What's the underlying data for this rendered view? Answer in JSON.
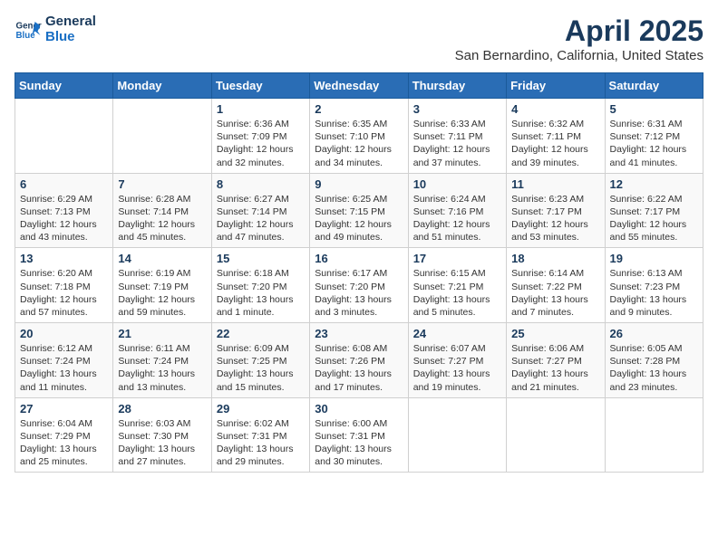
{
  "header": {
    "logo_line1": "General",
    "logo_line2": "Blue",
    "title": "April 2025",
    "subtitle": "San Bernardino, California, United States"
  },
  "weekdays": [
    "Sunday",
    "Monday",
    "Tuesday",
    "Wednesday",
    "Thursday",
    "Friday",
    "Saturday"
  ],
  "weeks": [
    [
      {
        "day": "",
        "info": ""
      },
      {
        "day": "",
        "info": ""
      },
      {
        "day": "1",
        "info": "Sunrise: 6:36 AM\nSunset: 7:09 PM\nDaylight: 12 hours\nand 32 minutes."
      },
      {
        "day": "2",
        "info": "Sunrise: 6:35 AM\nSunset: 7:10 PM\nDaylight: 12 hours\nand 34 minutes."
      },
      {
        "day": "3",
        "info": "Sunrise: 6:33 AM\nSunset: 7:11 PM\nDaylight: 12 hours\nand 37 minutes."
      },
      {
        "day": "4",
        "info": "Sunrise: 6:32 AM\nSunset: 7:11 PM\nDaylight: 12 hours\nand 39 minutes."
      },
      {
        "day": "5",
        "info": "Sunrise: 6:31 AM\nSunset: 7:12 PM\nDaylight: 12 hours\nand 41 minutes."
      }
    ],
    [
      {
        "day": "6",
        "info": "Sunrise: 6:29 AM\nSunset: 7:13 PM\nDaylight: 12 hours\nand 43 minutes."
      },
      {
        "day": "7",
        "info": "Sunrise: 6:28 AM\nSunset: 7:14 PM\nDaylight: 12 hours\nand 45 minutes."
      },
      {
        "day": "8",
        "info": "Sunrise: 6:27 AM\nSunset: 7:14 PM\nDaylight: 12 hours\nand 47 minutes."
      },
      {
        "day": "9",
        "info": "Sunrise: 6:25 AM\nSunset: 7:15 PM\nDaylight: 12 hours\nand 49 minutes."
      },
      {
        "day": "10",
        "info": "Sunrise: 6:24 AM\nSunset: 7:16 PM\nDaylight: 12 hours\nand 51 minutes."
      },
      {
        "day": "11",
        "info": "Sunrise: 6:23 AM\nSunset: 7:17 PM\nDaylight: 12 hours\nand 53 minutes."
      },
      {
        "day": "12",
        "info": "Sunrise: 6:22 AM\nSunset: 7:17 PM\nDaylight: 12 hours\nand 55 minutes."
      }
    ],
    [
      {
        "day": "13",
        "info": "Sunrise: 6:20 AM\nSunset: 7:18 PM\nDaylight: 12 hours\nand 57 minutes."
      },
      {
        "day": "14",
        "info": "Sunrise: 6:19 AM\nSunset: 7:19 PM\nDaylight: 12 hours\nand 59 minutes."
      },
      {
        "day": "15",
        "info": "Sunrise: 6:18 AM\nSunset: 7:20 PM\nDaylight: 13 hours\nand 1 minute."
      },
      {
        "day": "16",
        "info": "Sunrise: 6:17 AM\nSunset: 7:20 PM\nDaylight: 13 hours\nand 3 minutes."
      },
      {
        "day": "17",
        "info": "Sunrise: 6:15 AM\nSunset: 7:21 PM\nDaylight: 13 hours\nand 5 minutes."
      },
      {
        "day": "18",
        "info": "Sunrise: 6:14 AM\nSunset: 7:22 PM\nDaylight: 13 hours\nand 7 minutes."
      },
      {
        "day": "19",
        "info": "Sunrise: 6:13 AM\nSunset: 7:23 PM\nDaylight: 13 hours\nand 9 minutes."
      }
    ],
    [
      {
        "day": "20",
        "info": "Sunrise: 6:12 AM\nSunset: 7:24 PM\nDaylight: 13 hours\nand 11 minutes."
      },
      {
        "day": "21",
        "info": "Sunrise: 6:11 AM\nSunset: 7:24 PM\nDaylight: 13 hours\nand 13 minutes."
      },
      {
        "day": "22",
        "info": "Sunrise: 6:09 AM\nSunset: 7:25 PM\nDaylight: 13 hours\nand 15 minutes."
      },
      {
        "day": "23",
        "info": "Sunrise: 6:08 AM\nSunset: 7:26 PM\nDaylight: 13 hours\nand 17 minutes."
      },
      {
        "day": "24",
        "info": "Sunrise: 6:07 AM\nSunset: 7:27 PM\nDaylight: 13 hours\nand 19 minutes."
      },
      {
        "day": "25",
        "info": "Sunrise: 6:06 AM\nSunset: 7:27 PM\nDaylight: 13 hours\nand 21 minutes."
      },
      {
        "day": "26",
        "info": "Sunrise: 6:05 AM\nSunset: 7:28 PM\nDaylight: 13 hours\nand 23 minutes."
      }
    ],
    [
      {
        "day": "27",
        "info": "Sunrise: 6:04 AM\nSunset: 7:29 PM\nDaylight: 13 hours\nand 25 minutes."
      },
      {
        "day": "28",
        "info": "Sunrise: 6:03 AM\nSunset: 7:30 PM\nDaylight: 13 hours\nand 27 minutes."
      },
      {
        "day": "29",
        "info": "Sunrise: 6:02 AM\nSunset: 7:31 PM\nDaylight: 13 hours\nand 29 minutes."
      },
      {
        "day": "30",
        "info": "Sunrise: 6:00 AM\nSunset: 7:31 PM\nDaylight: 13 hours\nand 30 minutes."
      },
      {
        "day": "",
        "info": ""
      },
      {
        "day": "",
        "info": ""
      },
      {
        "day": "",
        "info": ""
      }
    ]
  ]
}
